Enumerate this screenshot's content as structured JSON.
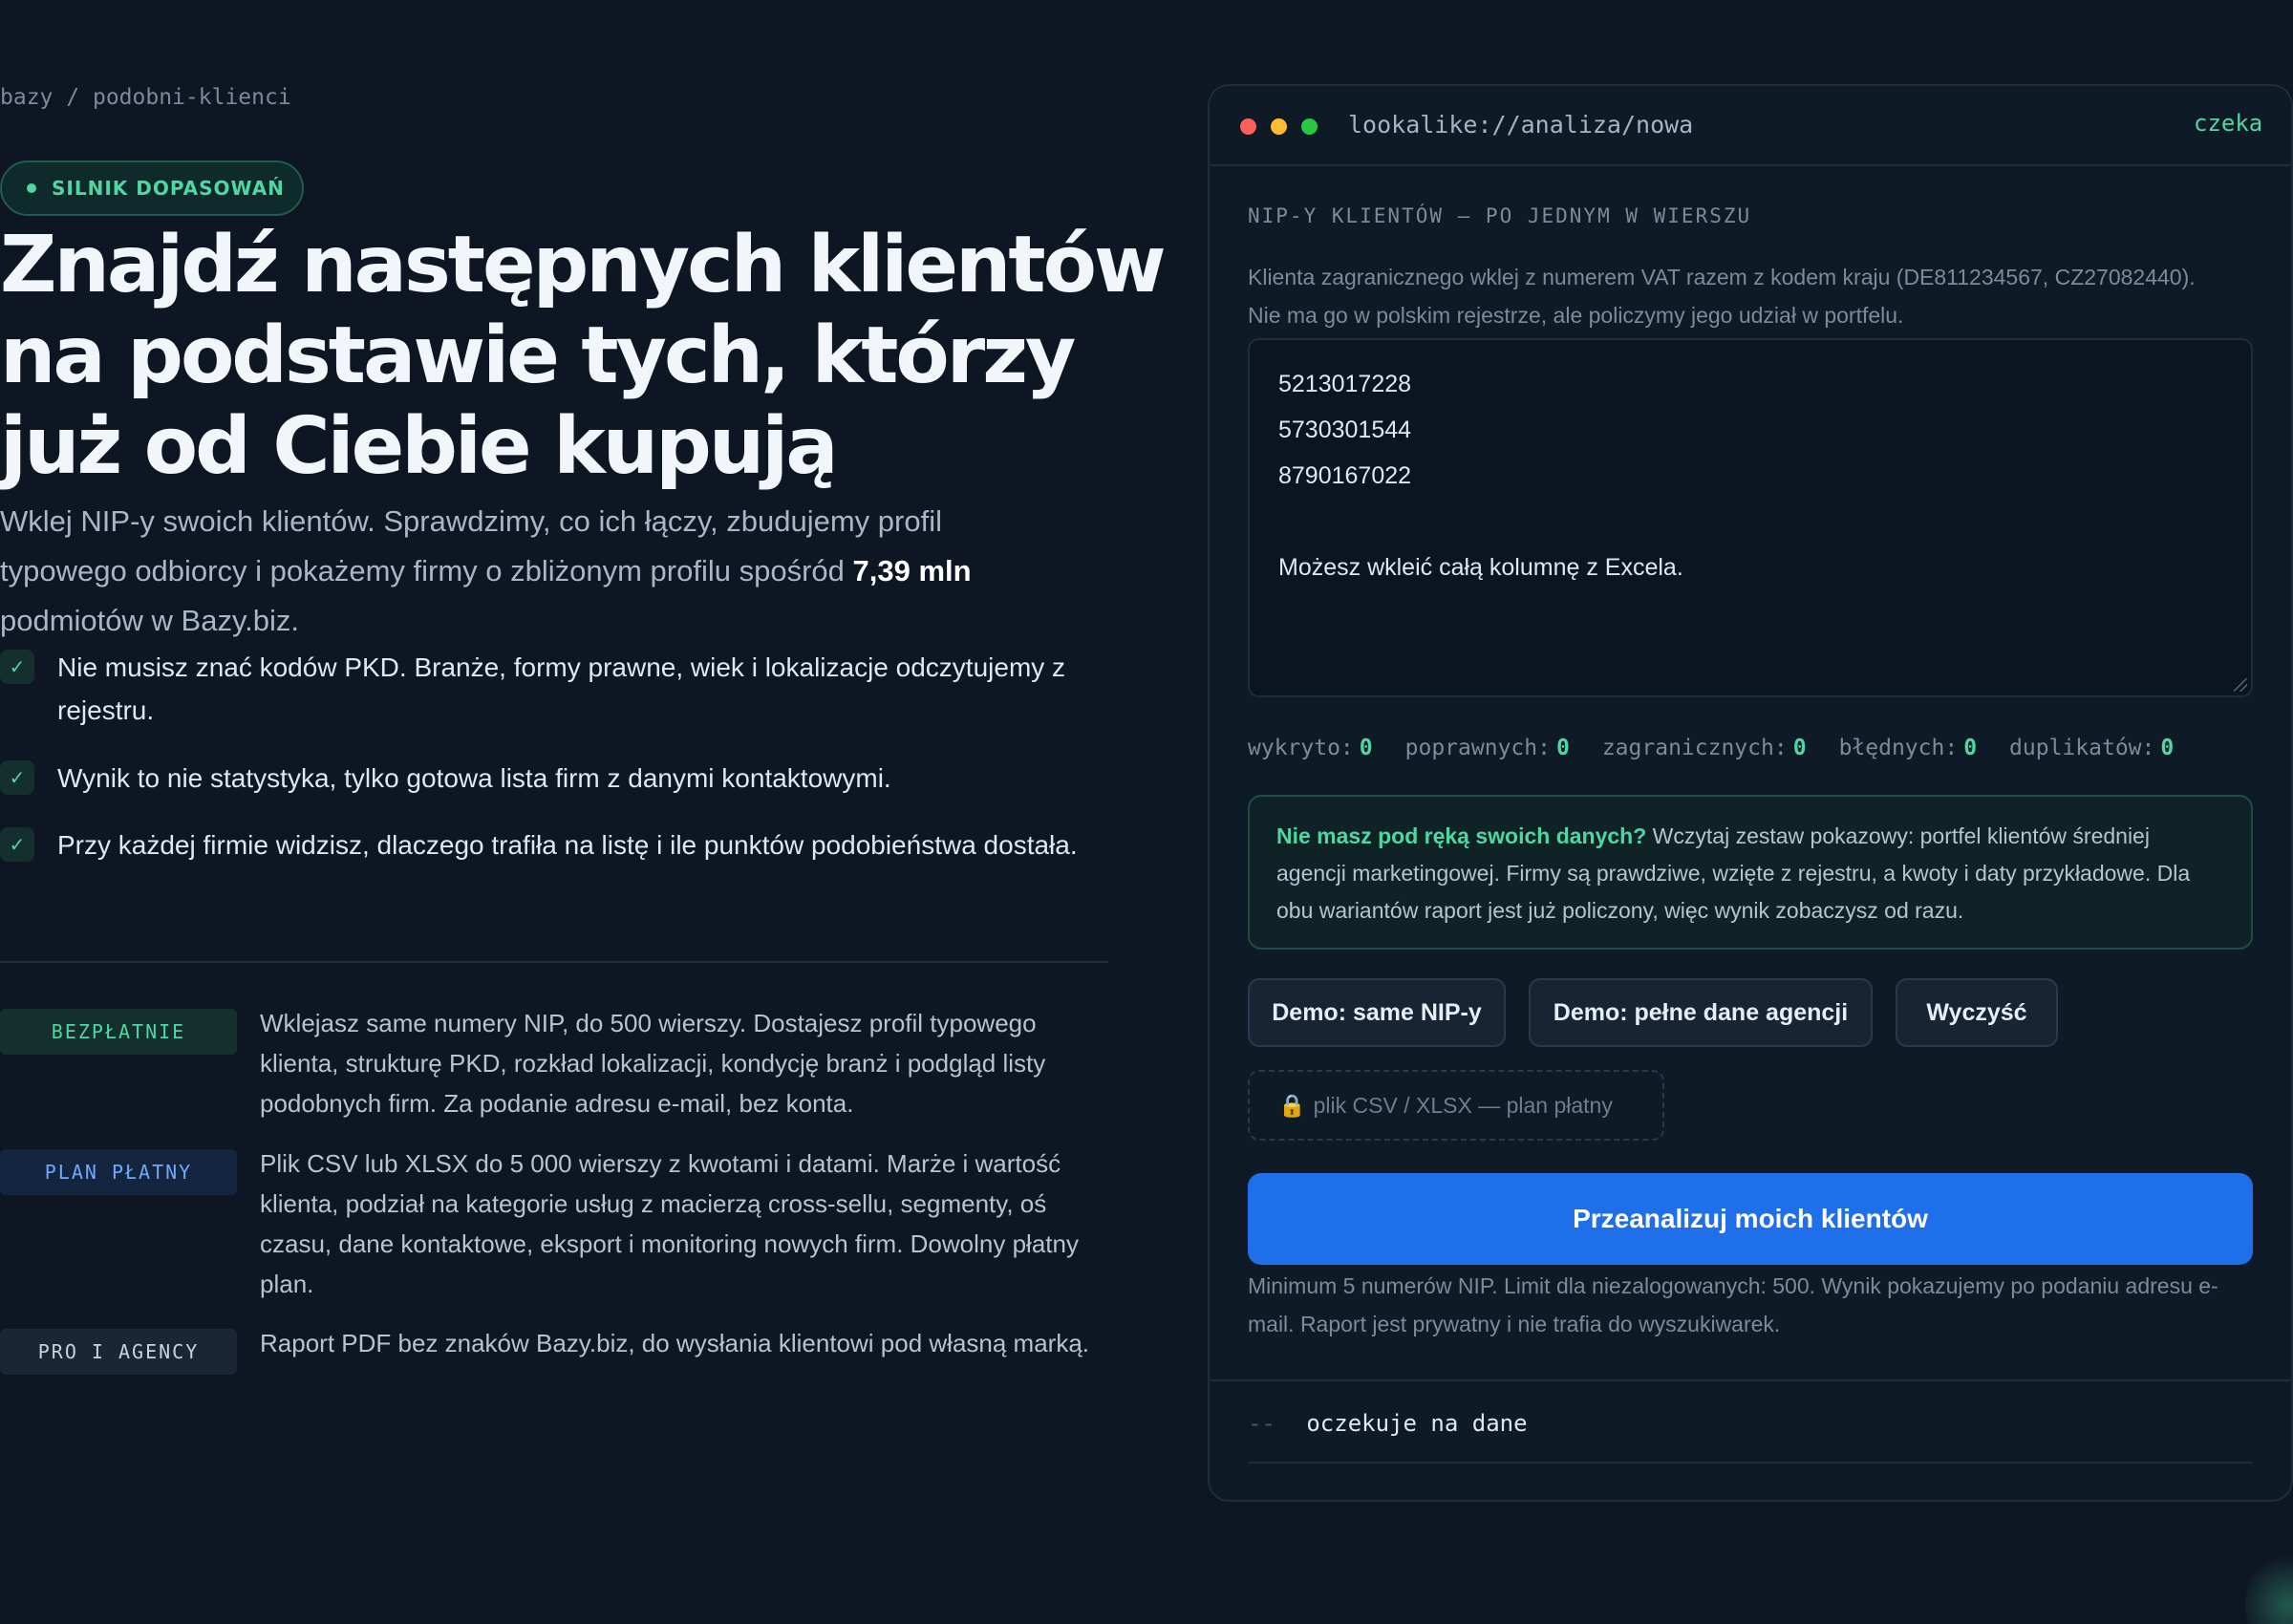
{
  "breadcrumb": {
    "root": "bazy",
    "separator": "/",
    "current": "podobni-klienci"
  },
  "badge": {
    "label": "SILNIK DOPASOWAŃ"
  },
  "hero": {
    "title_lines": [
      "Znajdź następnych klientów",
      "na podstawie tych, którzy",
      "już od Ciebie kupują"
    ],
    "lead_prefix": "Wklej NIP-y swoich klientów. Sprawdzimy, co ich łączy, zbudujemy profil typowego odbiorcy i pokażemy firmy o zbliżonym profilu spośród ",
    "lead_highlight": "7,39 mln",
    "lead_suffix": " podmiotów w Bazy.biz."
  },
  "checks": [
    {
      "icon": "check-icon",
      "text": "Nie musisz znać kodów PKD. Branże, formy prawne, wiek i lokalizacje odczytujemy z rejestru."
    },
    {
      "icon": "check-icon",
      "text": "Wynik to nie statystyka, tylko gotowa lista firm z danymi kontaktowymi."
    },
    {
      "icon": "check-icon",
      "text": "Przy każdej firmie widzisz, dlaczego trafiła na listę i ile punktów podobieństwa dostała."
    }
  ],
  "tiers": [
    {
      "tag": "BEZPŁATNIE",
      "color": "#4fd6a3",
      "bg": "#13302f",
      "text": "Wklejasz same numery NIP, do 500 wierszy. Dostajesz profil typowego klienta, strukturę PKD, rozkład lokalizacji, kondycję branż i podgląd listy podobnych firm. Za podanie adresu e-mail, bez konta."
    },
    {
      "tag": "PLAN PŁATNY",
      "color": "#6fa8ff",
      "bg": "#14263f",
      "text": "Plik CSV lub XLSX do 5 000 wierszy z kwotami i datami. Marże i wartość klienta, podział na kategorie usług z macierzą cross-sellu, segmenty, oś czasu, dane kontaktowe, eksport i monitoring nowych firm. Dowolny płatny plan."
    },
    {
      "tag": "PRO I AGENCY",
      "color": "#c9d3de",
      "bg": "#1a2634",
      "text": "Raport PDF bez znaków Bazy.biz, do wysłania klientowi pod własną marką."
    }
  ],
  "panel": {
    "window_colors": [
      "#ff5f57",
      "#febc2e",
      "#28c840"
    ],
    "url": "lookalike://analiza/nowa",
    "status": "czeka",
    "field_label": "NIP-Y KLIENTÓW — PO JEDNYM W WIERSZU",
    "hint": "Klienta zagranicznego wklej z numerem VAT razem z kodem kraju (DE811234567, CZ27082440). Nie ma go w polskim rejestrze, ale policzymy jego udział w portfelu.",
    "textarea_lines": [
      "5213017228",
      "5730301544",
      "8790167022"
    ],
    "textarea_note": "Możesz wkleić całą kolumnę z Excela.",
    "counters": [
      {
        "label": "wykryto:",
        "value": "0"
      },
      {
        "label": "poprawnych:",
        "value": "0"
      },
      {
        "label": "zagranicznych:",
        "value": "0"
      },
      {
        "label": "błędnych:",
        "value": "0"
      },
      {
        "label": "duplikatów:",
        "value": "0"
      }
    ],
    "demo_lead": "Nie masz pod ręką swoich danych?",
    "demo_text": " Wczytaj zestaw pokazowy: portfel klientów średniej agencji marketingowej. Firmy są prawdziwe, wzięte z rejestru, a kwoty i daty przykładowe. Dla obu wariantów raport jest już policzony, więc wynik zobaczysz od razu.",
    "buttons": {
      "demo_nip": "Demo: same NIP-y",
      "demo_full": "Demo: pełne dane agencji",
      "clear": "Wyczyść"
    },
    "upload_icon": "lock-icon",
    "upload_label": "plik CSV / XLSX — plan płatny",
    "submit": "Przeanalizuj moich klientów",
    "fine_print": "Minimum 5 numerów NIP. Limit dla niezalogowanych: 500. Wynik pokazujemy po podaniu adresu e-mail. Raport jest prywatny i nie trafia do wyszukiwarek.",
    "log_prompt": "--",
    "log_text": "oczekuje na dane"
  }
}
